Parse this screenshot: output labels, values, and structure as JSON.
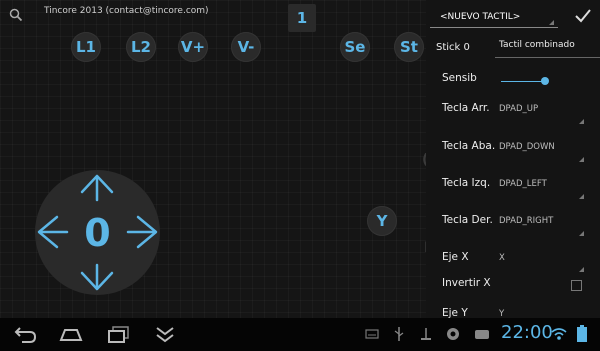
{
  "credit": "Tincore 2013 (contact@tincore.com)",
  "counter": "1",
  "buttons": {
    "l1": "L1",
    "l2": "L2",
    "vplus": "V+",
    "vminus": "V-",
    "se": "Se",
    "st": "St",
    "y": "Y"
  },
  "dpad": {
    "value": "0"
  },
  "panel": {
    "profile": "<NUEVO TACTIL>",
    "stick_label": "Stick 0",
    "stick_value": "Tactil combinado",
    "sensib_label": "Sensib",
    "sensib_level": 0.9,
    "rows": [
      {
        "label": "Tecla Arr.",
        "value": "DPAD_UP"
      },
      {
        "label": "Tecla Aba.",
        "value": "DPAD_DOWN"
      },
      {
        "label": "Tecla Izq.",
        "value": "DPAD_LEFT"
      },
      {
        "label": "Tecla Der.",
        "value": "DPAD_RIGHT"
      },
      {
        "label": "Eje X",
        "value": "X"
      },
      {
        "label": "Invertir X",
        "value": ""
      },
      {
        "label": "Eje Y",
        "value": "Y"
      }
    ]
  },
  "status": {
    "time": "22:00"
  },
  "colors": {
    "accent": "#5cb6e6",
    "background": "#151515"
  }
}
